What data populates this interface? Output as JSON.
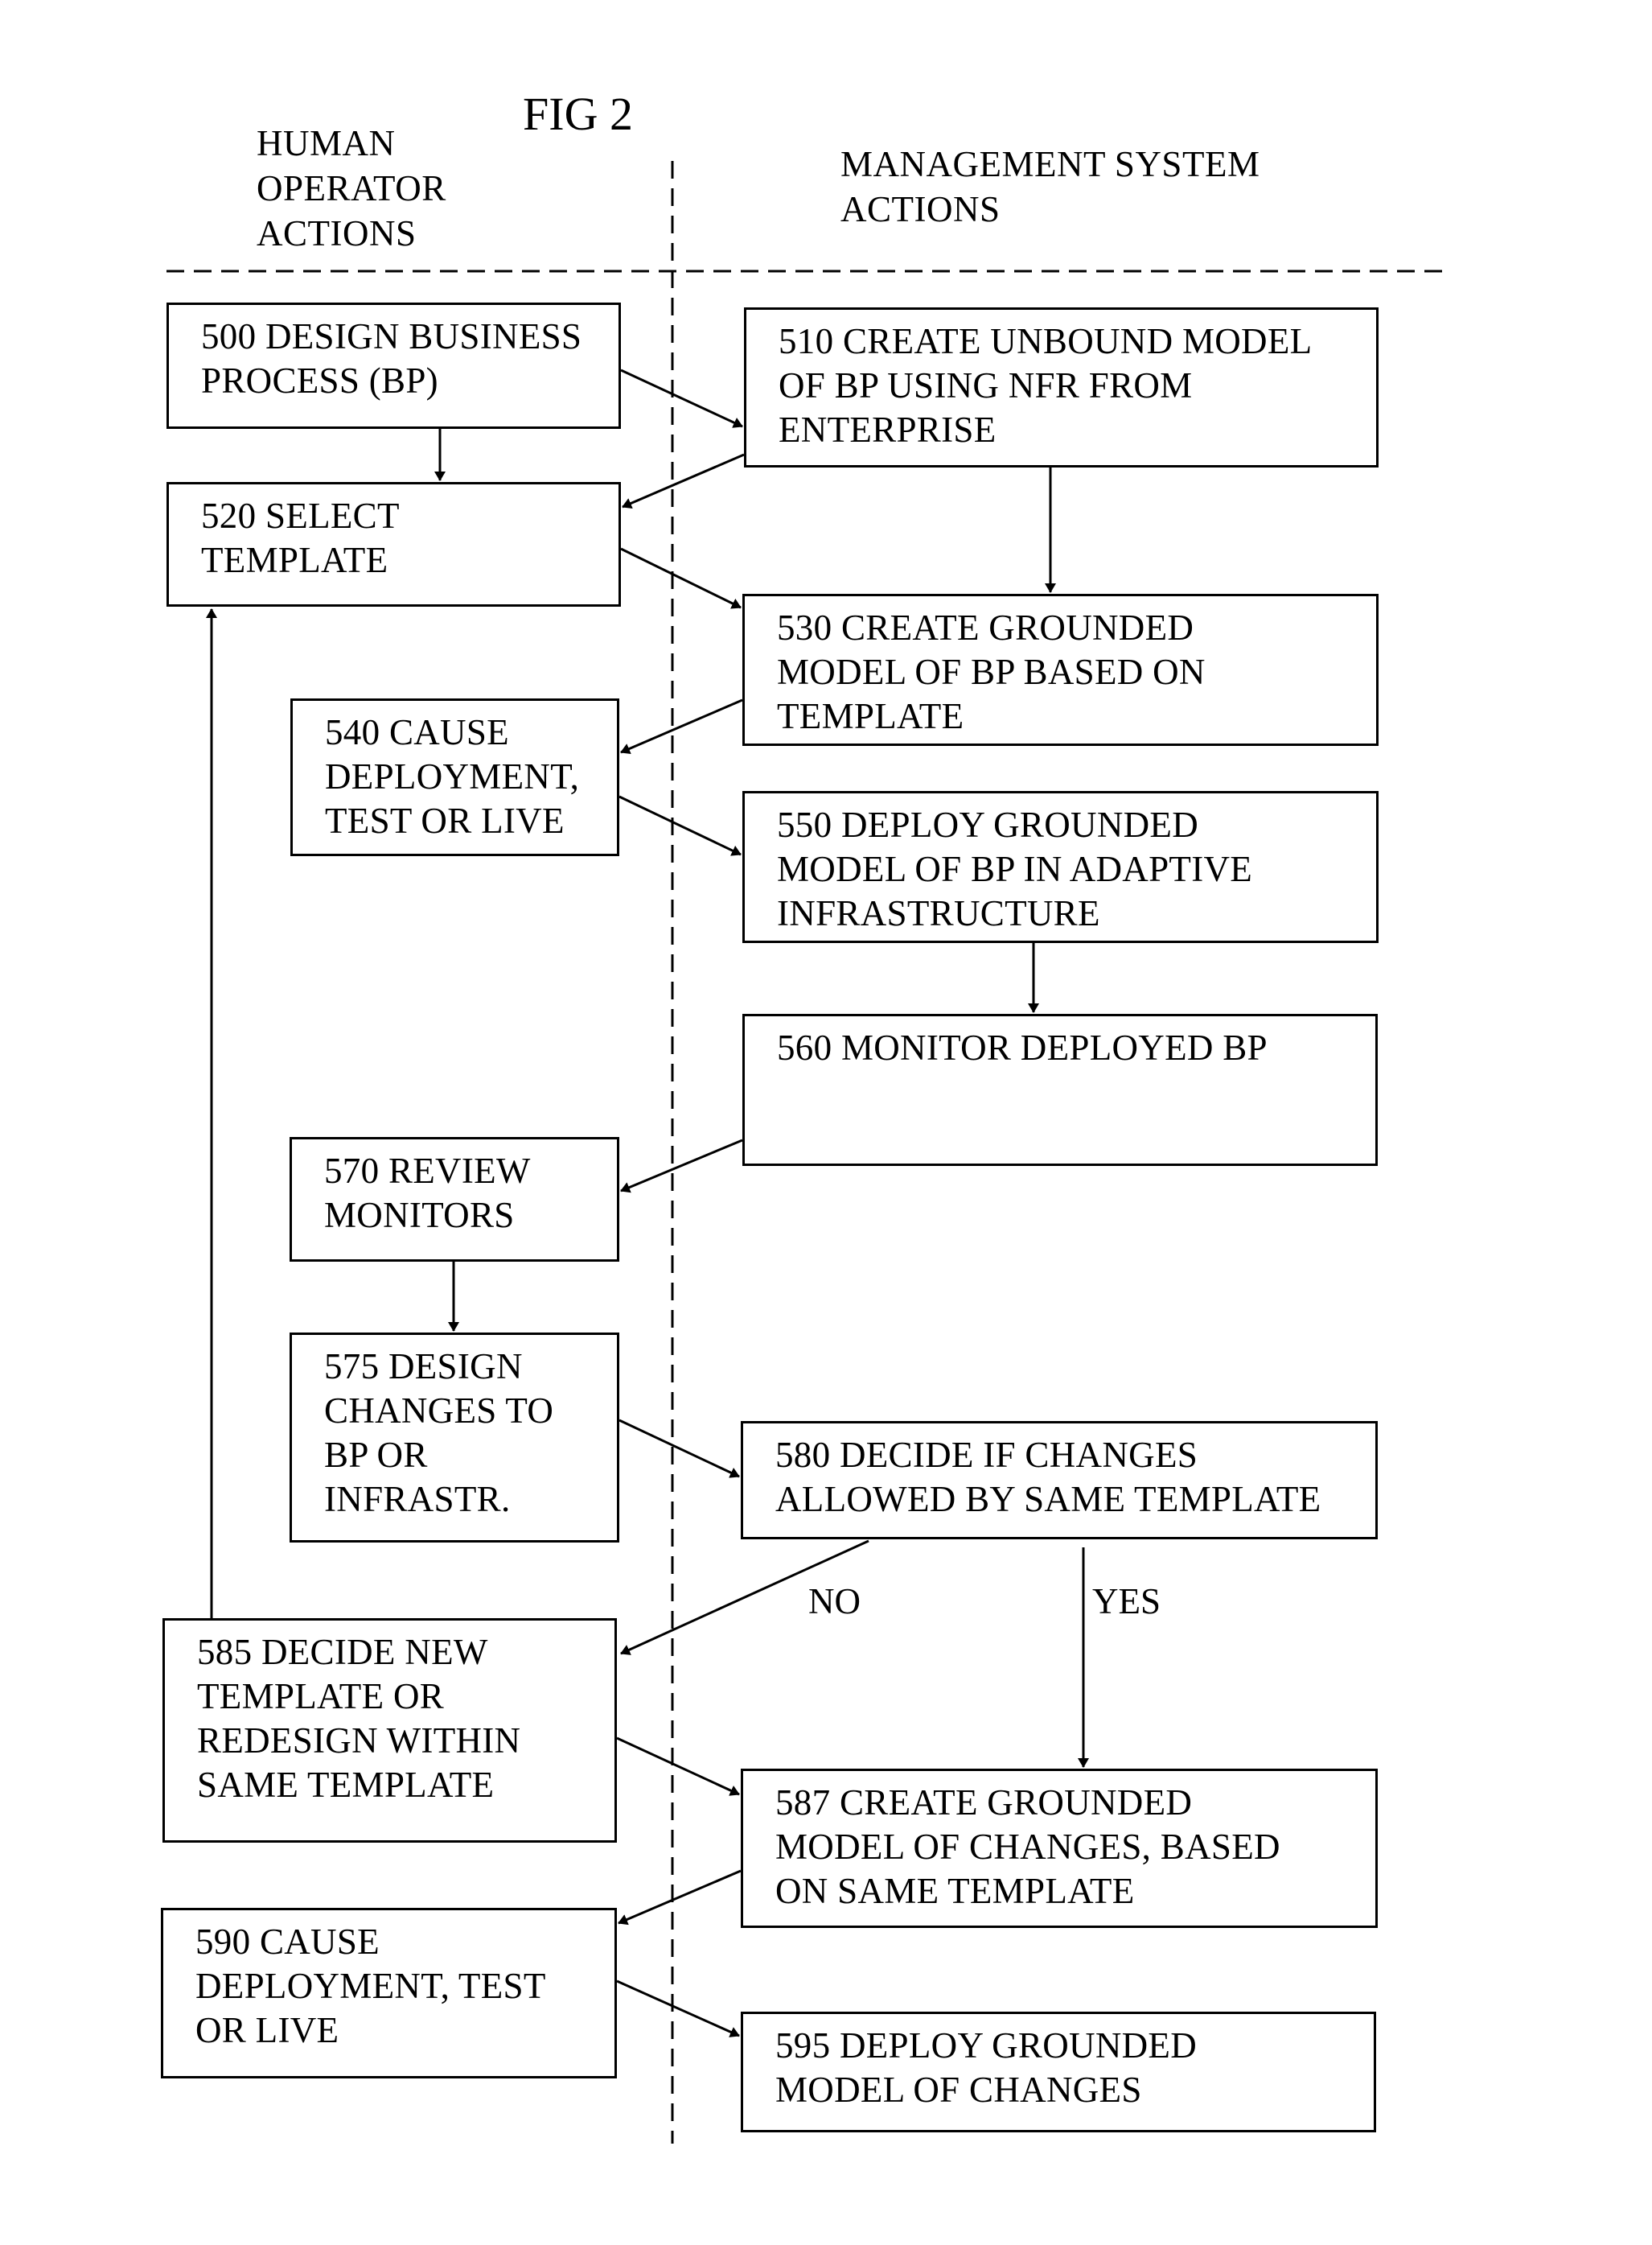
{
  "figure": {
    "title": "FIG 2",
    "lanes": {
      "left": "HUMAN\nOPERATOR\nACTIONS",
      "right": "MANAGEMENT SYSTEM\nACTIONS"
    }
  },
  "nodes": [
    {
      "id": "500",
      "lane": "human",
      "text": "500 DESIGN BUSINESS\nPROCESS (BP)"
    },
    {
      "id": "510",
      "lane": "system",
      "text": "510 CREATE UNBOUND MODEL\nOF BP USING NFR FROM\nENTERPRISE"
    },
    {
      "id": "520",
      "lane": "human",
      "text": "520 SELECT\nTEMPLATE"
    },
    {
      "id": "530",
      "lane": "system",
      "text": "530 CREATE GROUNDED\nMODEL OF BP BASED ON\nTEMPLATE"
    },
    {
      "id": "540",
      "lane": "human",
      "text": "540 CAUSE\nDEPLOYMENT,\nTEST OR LIVE"
    },
    {
      "id": "550",
      "lane": "system",
      "text": "550 DEPLOY GROUNDED\nMODEL OF BP IN ADAPTIVE\nINFRASTRUCTURE"
    },
    {
      "id": "560",
      "lane": "system",
      "text": "560 MONITOR DEPLOYED BP"
    },
    {
      "id": "570",
      "lane": "human",
      "text": "570 REVIEW\nMONITORS"
    },
    {
      "id": "575",
      "lane": "human",
      "text": "575 DESIGN\nCHANGES TO\nBP OR\nINFRASTR."
    },
    {
      "id": "580",
      "lane": "system",
      "text": "580 DECIDE IF CHANGES\nALLOWED BY SAME TEMPLATE"
    },
    {
      "id": "585",
      "lane": "human",
      "text": "585 DECIDE NEW\nTEMPLATE OR\nREDESIGN WITHIN\nSAME TEMPLATE"
    },
    {
      "id": "587",
      "lane": "system",
      "text": "587 CREATE GROUNDED\nMODEL OF CHANGES, BASED\nON SAME TEMPLATE"
    },
    {
      "id": "590",
      "lane": "human",
      "text": "590 CAUSE\nDEPLOYMENT, TEST\nOR LIVE"
    },
    {
      "id": "595",
      "lane": "system",
      "text": "595 DEPLOY GROUNDED\nMODEL OF CHANGES"
    }
  ],
  "edges": [
    {
      "from": "500",
      "to": "510",
      "label": ""
    },
    {
      "from": "500",
      "to": "520",
      "label": ""
    },
    {
      "from": "510",
      "to": "520",
      "label": ""
    },
    {
      "from": "510",
      "to": "530",
      "label": ""
    },
    {
      "from": "520",
      "to": "530",
      "label": ""
    },
    {
      "from": "530",
      "to": "540",
      "label": ""
    },
    {
      "from": "540",
      "to": "550",
      "label": ""
    },
    {
      "from": "550",
      "to": "560",
      "label": ""
    },
    {
      "from": "560",
      "to": "570",
      "label": ""
    },
    {
      "from": "570",
      "to": "575",
      "label": ""
    },
    {
      "from": "575",
      "to": "580",
      "label": ""
    },
    {
      "from": "580",
      "to": "585",
      "label": "NO"
    },
    {
      "from": "580",
      "to": "587",
      "label": "YES"
    },
    {
      "from": "585",
      "to": "520",
      "label": ""
    },
    {
      "from": "585",
      "to": "587",
      "label": ""
    },
    {
      "from": "587",
      "to": "590",
      "label": ""
    },
    {
      "from": "590",
      "to": "595",
      "label": ""
    }
  ]
}
